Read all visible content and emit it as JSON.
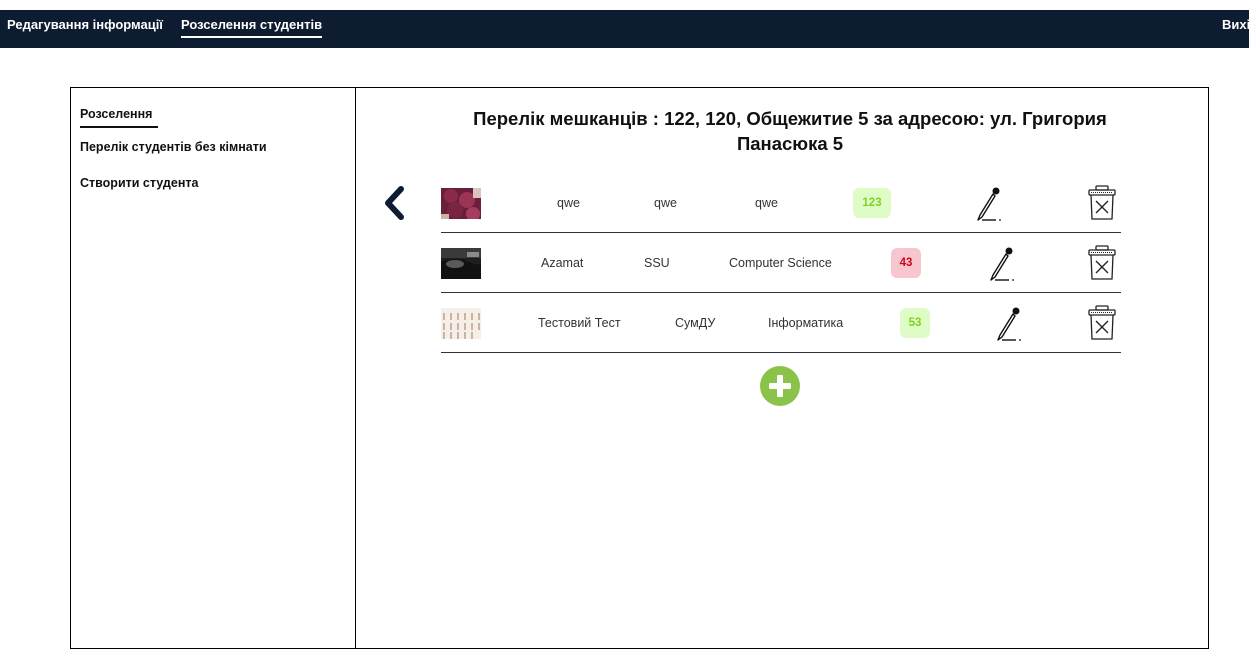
{
  "nav": {
    "edit_label": "Редагування інформації",
    "settle_label": "Розселення студентів",
    "exit_label": "Вихі"
  },
  "sidebar": {
    "items": [
      {
        "label": "Розселення"
      },
      {
        "label": "Перелік студентів без кімнати"
      },
      {
        "label": "Створити студента"
      }
    ]
  },
  "main": {
    "title": "Перелік мешканців : 122, 120, Общежитие 5 за адресою: ул. Григория Панасюка 5",
    "rows": [
      {
        "name": "qwe",
        "university": "qwe",
        "specialty": "qwe",
        "badge": "123",
        "badge_color": "#dffcc6",
        "badge_text_color": "#7ed321"
      },
      {
        "name": "Azamat",
        "university": "SSU",
        "specialty": "Computer Science",
        "badge": "43",
        "badge_color": "#f7c6cf",
        "badge_text_color": "#d0021b"
      },
      {
        "name": "Тестовий Тест",
        "university": "СумДУ",
        "specialty": "Інформатика",
        "badge": "53",
        "badge_color": "#dffcc6",
        "badge_text_color": "#7ed321"
      }
    ]
  },
  "icons": {
    "back": "chevron-left-icon",
    "edit": "pencil-icon",
    "delete": "trash-icon",
    "add": "plus-circle-icon"
  },
  "colors": {
    "topbar": "#0d1c30",
    "add_button": "#8bc34a"
  }
}
